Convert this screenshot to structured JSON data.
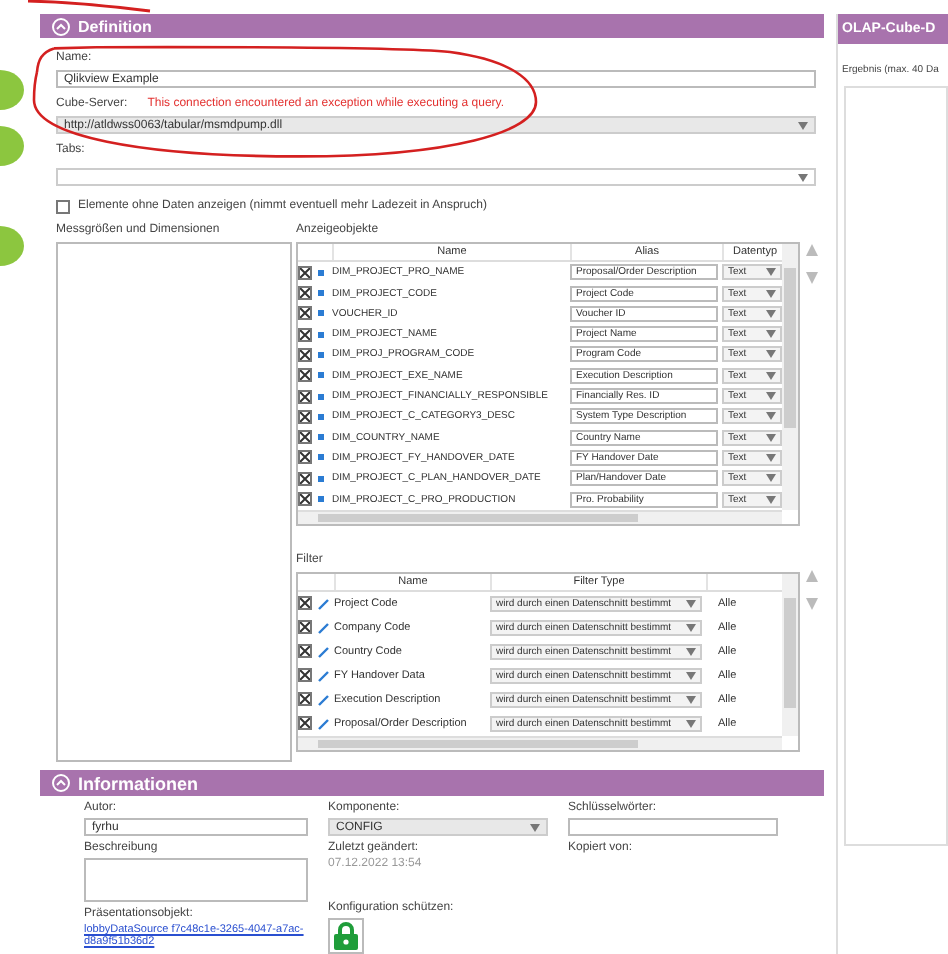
{
  "definition": {
    "title": "Definition",
    "name_label": "Name:",
    "name_value": "Qlikview Example",
    "server_label": "Cube-Server:",
    "server_error": "This connection encountered an exception while executing a query.",
    "server_value": "http://atldwss0063/tabular/msmdpump.dll",
    "table_label": "Tabs:",
    "empty_items": {
      "label": "Elemente ohne Daten anzeigen (nimmt eventuell mehr Ladezeit in Anspruch)",
      "checked": false
    },
    "measures_label": "Messgrößen und Dimensionen",
    "display_label": "Anzeigeobjekte",
    "display_columns": [
      "Name",
      "Alias",
      "Datentyp"
    ],
    "display_rows": [
      {
        "checked": true,
        "name": "DIM_PROJECT_PRO_NAME",
        "alias": "Proposal/Order Description",
        "type": "Text"
      },
      {
        "checked": true,
        "name": "DIM_PROJECT_CODE",
        "alias": "Project Code",
        "type": "Text"
      },
      {
        "checked": true,
        "name": "VOUCHER_ID",
        "alias": "Voucher ID",
        "type": "Text"
      },
      {
        "checked": true,
        "name": "DIM_PROJECT_NAME",
        "alias": "Project Name",
        "type": "Text"
      },
      {
        "checked": true,
        "name": "DIM_PROJ_PROGRAM_CODE",
        "alias": "Program Code",
        "type": "Text"
      },
      {
        "checked": true,
        "name": "DIM_PROJECT_EXE_NAME",
        "alias": "Execution Description",
        "type": "Text"
      },
      {
        "checked": true,
        "name": "DIM_PROJECT_FINANCIALLY_RESPONSIBLE",
        "alias": "Financially Res. ID",
        "type": "Text"
      },
      {
        "checked": true,
        "name": "DIM_PROJECT_C_CATEGORY3_DESC",
        "alias": "System Type Description",
        "type": "Text"
      },
      {
        "checked": true,
        "name": "DIM_COUNTRY_NAME",
        "alias": "Country Name",
        "type": "Text"
      },
      {
        "checked": true,
        "name": "DIM_PROJECT_FY_HANDOVER_DATE",
        "alias": "FY Handover Date",
        "type": "Text"
      },
      {
        "checked": true,
        "name": "DIM_PROJECT_C_PLAN_HANDOVER_DATE",
        "alias": "Plan/Handover Date",
        "type": "Text"
      },
      {
        "checked": true,
        "name": "DIM_PROJECT_C_PRO_PRODUCTION",
        "alias": "Pro. Probability",
        "type": "Text"
      }
    ],
    "filter_label": "Filter",
    "filter_columns": [
      "Name",
      "Filter Type"
    ],
    "filter_rows": [
      {
        "checked": true,
        "name": "Project Code",
        "filter_type": "wird durch einen Datenschnitt bestimmt",
        "value": "Alle"
      },
      {
        "checked": true,
        "name": "Company Code",
        "filter_type": "wird durch einen Datenschnitt bestimmt",
        "value": "Alle"
      },
      {
        "checked": true,
        "name": "Country Code",
        "filter_type": "wird durch einen Datenschnitt bestimmt",
        "value": "Alle"
      },
      {
        "checked": true,
        "name": "FY Handover Data",
        "filter_type": "wird durch einen Datenschnitt bestimmt",
        "value": "Alle"
      },
      {
        "checked": true,
        "name": "Execution Description",
        "filter_type": "wird durch einen Datenschnitt bestimmt",
        "value": "Alle"
      },
      {
        "checked": true,
        "name": "Proposal/Order Description",
        "filter_type": "wird durch einen Datenschnitt bestimmt",
        "value": "Alle"
      }
    ]
  },
  "information": {
    "title": "Informationen",
    "author_label": "Autor:",
    "author_value": "fyrhu",
    "description_label": "Beschreibung",
    "presentation_label": "Präsentationsobjekt:",
    "presentation_link": "lobbyDataSource f7c48c1e-3265-4047-a7ac-d8a9f51b36d2",
    "component_label": "Komponente:",
    "component_value": "CONFIG",
    "changed_label": "Zuletzt geändert:",
    "changed_value": "07.12.2022 13:54",
    "protect_label": "Konfiguration schützen:",
    "keywords_label": "Schlüsselwörter:",
    "copied_label": "Kopiert von:"
  },
  "right_panel": {
    "title": "OLAP-Cube-D",
    "result_label": "Ergebnis (max. 40 Da"
  }
}
